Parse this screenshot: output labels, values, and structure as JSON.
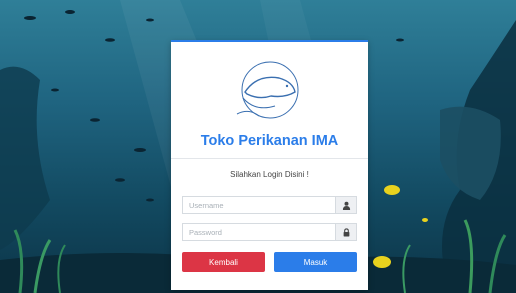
{
  "background": {
    "scene": "underwater",
    "colors": {
      "water_top": "#2f7f98",
      "water_bottom": "#0c3447",
      "fish_yellow": "#e8d21e"
    }
  },
  "login_card": {
    "title": "Toko Perikanan IMA",
    "subtitle": "Silahkan Login Disini !",
    "username_placeholder": "Username",
    "password_placeholder": "Password",
    "username_value": "",
    "password_value": "",
    "user_icon": "user-icon",
    "lock_icon": "lock-icon",
    "back_button_label": "Kembali",
    "login_button_label": "Masuk",
    "colors": {
      "accent": "#2b7de9",
      "danger": "#dc3545"
    }
  }
}
